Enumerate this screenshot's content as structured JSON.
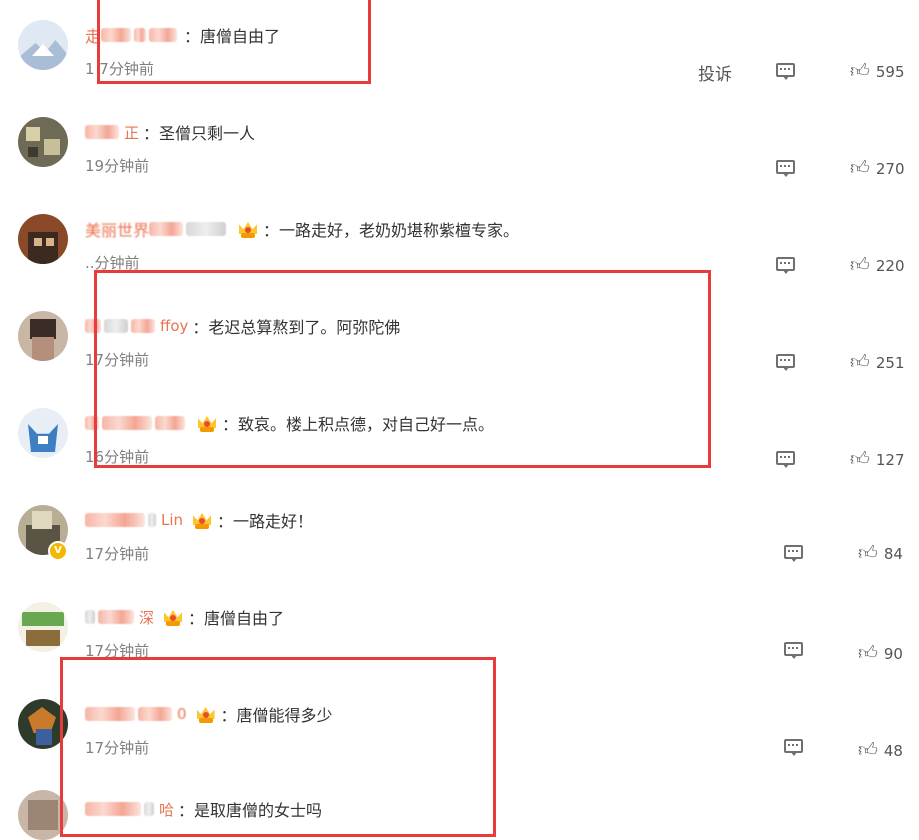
{
  "report_label": "投诉",
  "comments": [
    {
      "name_visible": "走",
      "name_tail": "",
      "crown": false,
      "text": "：唐僧自由了",
      "time": "1 7分钟前",
      "likes": "595",
      "verified": false
    },
    {
      "name_visible": "",
      "name_tail": "正",
      "crown": false,
      "text": "：圣僧只剩一人",
      "time": "19分钟前",
      "likes": "270",
      "verified": false
    },
    {
      "name_visible": "美丽世界",
      "name_tail": "",
      "crown": true,
      "text": "：一路走好，老奶奶堪称紫檀专家。",
      "time": "..分钟前",
      "likes": "220",
      "verified": false
    },
    {
      "name_visible": "",
      "name_tail": "ffoy",
      "crown": false,
      "text": "：老迟总算熬到了。阿弥陀佛",
      "time": "17分钟前",
      "likes": "251",
      "verified": false
    },
    {
      "name_visible": "",
      "name_tail": "",
      "crown": true,
      "text": "：致哀。楼上积点德，对自己好一点。",
      "time": "16分钟前",
      "likes": "127",
      "verified": false
    },
    {
      "name_visible": "",
      "name_tail": "Lin",
      "crown": true,
      "text": "：一路走好！",
      "time": "17分钟前",
      "likes": "84",
      "verified": true
    },
    {
      "name_visible": "",
      "name_tail": "深",
      "crown": true,
      "text": "：唐僧自由了",
      "time": "17分钟前",
      "likes": "90",
      "verified": false
    },
    {
      "name_visible": "",
      "name_tail": "0",
      "crown": true,
      "text": "：唐僧能得多少",
      "time": "17分钟前",
      "likes": "48",
      "verified": false
    },
    {
      "name_visible": "",
      "name_tail": "哈",
      "crown": false,
      "text": "：是取唐僧的女士吗",
      "time": "",
      "likes": "",
      "verified": false
    }
  ],
  "icons": {
    "reply": "comment-bubble-icon",
    "like": "thumbs-up-icon",
    "crown": "crown-badge-icon",
    "verified": "verified-v-icon"
  },
  "colors": {
    "username": "#eb7350",
    "highlight_box": "#e83b3b",
    "timestamp": "#808080"
  }
}
